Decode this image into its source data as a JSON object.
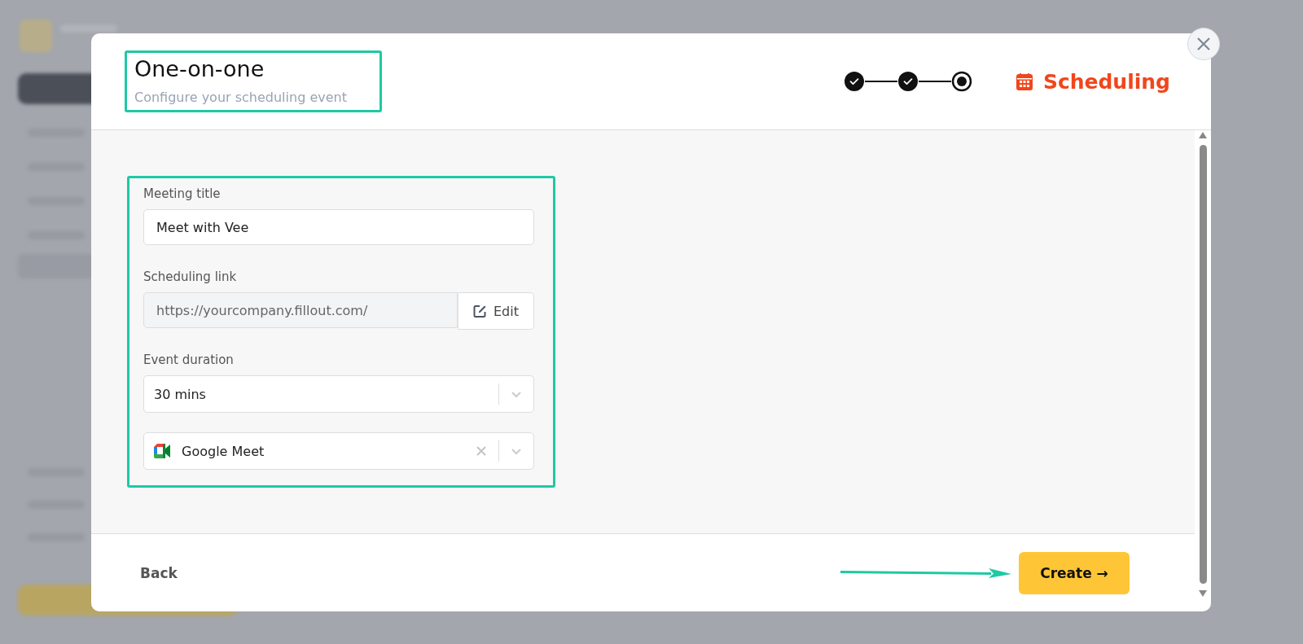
{
  "modal": {
    "title": "One-on-one",
    "subtitle": "Configure your scheduling event",
    "steps": [
      {
        "completed": true,
        "selected": false
      },
      {
        "completed": true,
        "selected": false
      },
      {
        "completed": false,
        "selected": true
      }
    ],
    "section_label": "Scheduling",
    "form": {
      "meeting_title": {
        "label": "Meeting title",
        "value": "Meet with Vee"
      },
      "scheduling_link": {
        "label": "Scheduling link",
        "value": "https://yourcompany.fillout.com/",
        "disabled": true,
        "button": "Edit"
      },
      "event_duration": {
        "label": "Event duration",
        "value": "30 mins"
      },
      "location": {
        "value": "Google Meet",
        "clearable": true
      }
    },
    "buttons": {
      "back": "Back",
      "create": "Create →"
    }
  }
}
